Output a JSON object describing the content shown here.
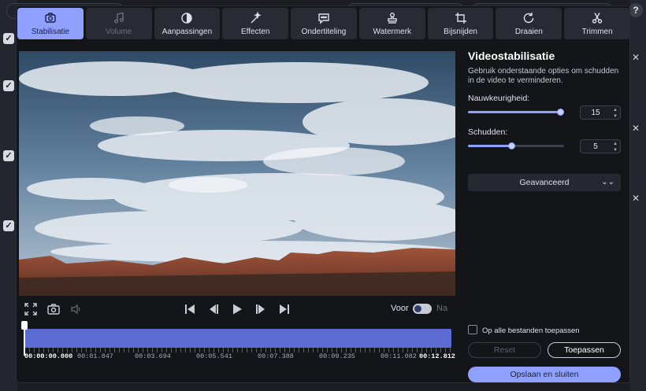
{
  "toolbar": {
    "tabs": [
      {
        "label": "Stabilisatie",
        "icon": "stabilize-icon",
        "state": "active"
      },
      {
        "label": "Volume",
        "icon": "music-note-icon",
        "state": "disabled"
      },
      {
        "label": "Aanpassingen",
        "icon": "contrast-icon",
        "state": "normal"
      },
      {
        "label": "Effecten",
        "icon": "magic-wand-icon",
        "state": "normal"
      },
      {
        "label": "Ondertiteling",
        "icon": "speech-bubble-icon",
        "state": "normal"
      },
      {
        "label": "Watermerk",
        "icon": "stamp-icon",
        "state": "normal"
      },
      {
        "label": "Bijsnijden",
        "icon": "crop-icon",
        "state": "normal"
      },
      {
        "label": "Draaien",
        "icon": "rotate-icon",
        "state": "normal"
      },
      {
        "label": "Trimmen",
        "icon": "scissors-icon",
        "state": "normal"
      }
    ]
  },
  "player": {
    "before_label": "Voor",
    "after_label": "Na",
    "compare_enabled": false
  },
  "timeline": {
    "start": "00:00:00.000",
    "marks": [
      "00:01.847",
      "00:03.694",
      "00:05.541",
      "00:07.388",
      "00:09.235",
      "00:11.082"
    ],
    "end": "00:12.812",
    "position": 0
  },
  "panel": {
    "title": "Videostabilisatie",
    "description": "Gebruik onderstaande opties om schudden in de video te verminderen.",
    "accuracy": {
      "label": "Nauwkeurigheid:",
      "value": "15",
      "level": 1.0
    },
    "shake": {
      "label": "Schudden:",
      "value": "5",
      "level": 0.45
    },
    "advanced_label": "Geavanceerd",
    "apply_all_label": "Op alle bestanden toepassen",
    "apply_all_checked": false,
    "reset_label": "Reset",
    "apply_label": "Toepassen",
    "save_label": "Opslaan en sluiten"
  },
  "colors": {
    "accent": "#8fa0ff",
    "timeline": "#5b6bd2",
    "background": "#141519"
  }
}
